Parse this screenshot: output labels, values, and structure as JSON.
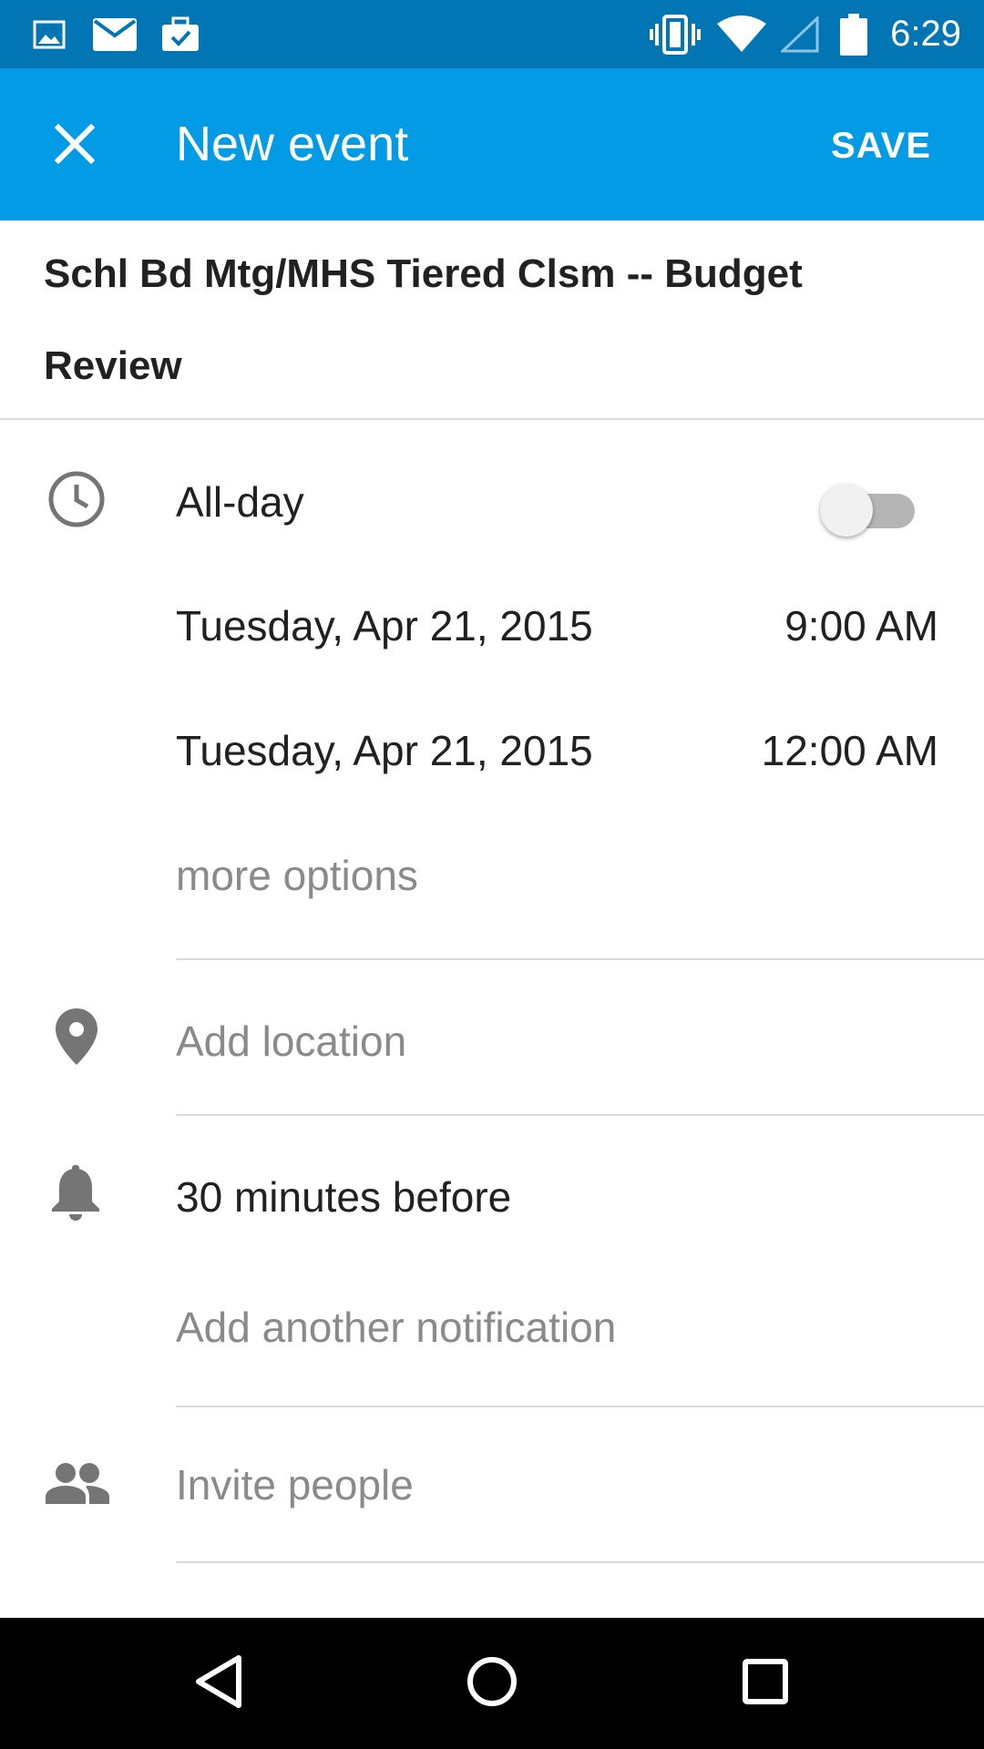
{
  "status_bar": {
    "time": "6:29",
    "icons": [
      "image-icon",
      "mail-icon",
      "briefcase-check-icon",
      "vibrate-icon",
      "wifi-icon",
      "cell-signal-icon",
      "battery-icon"
    ]
  },
  "app_bar": {
    "title": "New event",
    "save_label": "SAVE",
    "color": "#039be5"
  },
  "event": {
    "title": "Schl Bd Mtg/MHS Tiered Clsm -- Budget Review",
    "all_day_label": "All-day",
    "all_day_on": false,
    "start_date": "Tuesday, Apr 21, 2015",
    "start_time": "9:00 AM",
    "end_date": "Tuesday, Apr 21, 2015",
    "end_time": "12:00 AM",
    "more_options": "more options",
    "location_placeholder": "Add location",
    "notification": "30 minutes before",
    "add_notification": "Add another notification",
    "invite_placeholder": "Invite people"
  },
  "nav_bar": {
    "buttons": [
      "back-icon",
      "home-icon",
      "recents-icon"
    ]
  }
}
